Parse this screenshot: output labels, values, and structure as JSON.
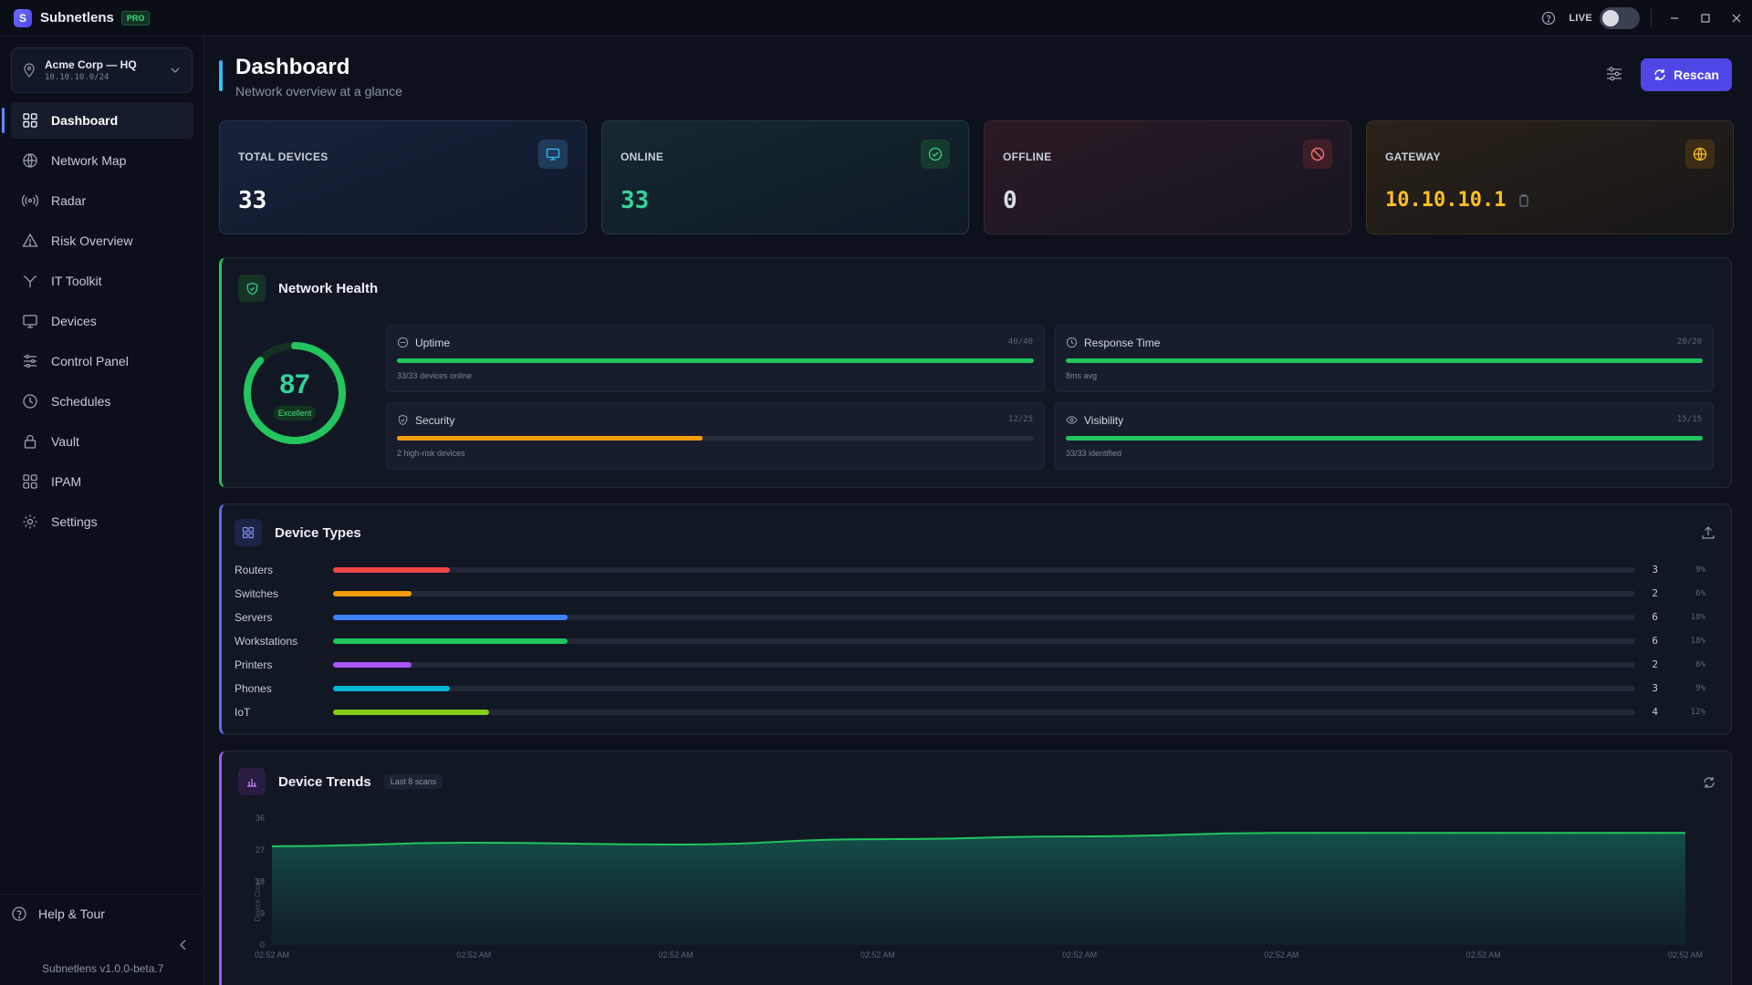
{
  "app": {
    "name": "Subnetlens",
    "badge": "PRO",
    "live_label": "LIVE",
    "version": "Subnetlens v1.0.0-beta.7"
  },
  "site": {
    "name": "Acme Corp — HQ",
    "subnet": "10.10.10.0/24"
  },
  "sidebar": {
    "items": [
      {
        "label": "Dashboard",
        "icon": "grid-icon",
        "active": true
      },
      {
        "label": "Network Map",
        "icon": "globe-icon"
      },
      {
        "label": "Radar",
        "icon": "radar-icon"
      },
      {
        "label": "Risk Overview",
        "icon": "warning-icon"
      },
      {
        "label": "IT Toolkit",
        "icon": "toolkit-icon"
      },
      {
        "label": "Devices",
        "icon": "monitor-icon"
      },
      {
        "label": "Control Panel",
        "icon": "sliders-icon"
      },
      {
        "label": "Schedules",
        "icon": "clock-icon"
      },
      {
        "label": "Vault",
        "icon": "lock-icon"
      },
      {
        "label": "IPAM",
        "icon": "ipam-icon"
      },
      {
        "label": "Settings",
        "icon": "gear-icon"
      }
    ],
    "help_label": "Help & Tour"
  },
  "header": {
    "title": "Dashboard",
    "subtitle": "Network overview at a glance",
    "rescan_label": "Rescan"
  },
  "stats": {
    "total": {
      "label": "TOTAL DEVICES",
      "value": "33",
      "color": "#ffffff"
    },
    "online": {
      "label": "ONLINE",
      "value": "33",
      "color": "#34d399"
    },
    "offline": {
      "label": "OFFLINE",
      "value": "0",
      "color": "#d8dce4"
    },
    "gateway": {
      "label": "GATEWAY",
      "value": "10.10.10.1",
      "color": "#fbbf24"
    }
  },
  "health": {
    "title": "Network Health",
    "score": "87",
    "score_fraction": 0.87,
    "rating": "Excellent",
    "metrics": {
      "uptime": {
        "label": "Uptime",
        "score": "40/40",
        "sub": "33/33 devices online",
        "fraction": 1.0,
        "color": "#22c55e"
      },
      "response": {
        "label": "Response Time",
        "score": "20/20",
        "sub": "8ms avg",
        "fraction": 1.0,
        "color": "#22c55e"
      },
      "security": {
        "label": "Security",
        "score": "12/25",
        "sub": "2 high-risk devices",
        "fraction": 0.48,
        "color": "#f59e0b"
      },
      "visibility": {
        "label": "Visibility",
        "score": "15/15",
        "sub": "33/33 identified",
        "fraction": 1.0,
        "color": "#22c55e"
      }
    }
  },
  "device_types": {
    "title": "Device Types",
    "rows": [
      {
        "label": "Routers",
        "count": "3",
        "pct": "9%",
        "fraction": 0.09,
        "color": "#ef4444"
      },
      {
        "label": "Switches",
        "count": "2",
        "pct": "6%",
        "fraction": 0.06,
        "color": "#f59e0b"
      },
      {
        "label": "Servers",
        "count": "6",
        "pct": "18%",
        "fraction": 0.18,
        "color": "#3b82f6"
      },
      {
        "label": "Workstations",
        "count": "6",
        "pct": "18%",
        "fraction": 0.18,
        "color": "#22c55e"
      },
      {
        "label": "Printers",
        "count": "2",
        "pct": "6%",
        "fraction": 0.06,
        "color": "#a855f7"
      },
      {
        "label": "Phones",
        "count": "3",
        "pct": "9%",
        "fraction": 0.09,
        "color": "#06b6d4"
      },
      {
        "label": "IoT",
        "count": "4",
        "pct": "12%",
        "fraction": 0.12,
        "color": "#84cc16"
      }
    ]
  },
  "trends": {
    "title": "Device Trends",
    "range": "Last 8 scans"
  },
  "chart_data": {
    "type": "area",
    "title": "Device Trends",
    "ylabel": "Device Count",
    "ylim": [
      0,
      36
    ],
    "yticks": [
      "0",
      "9",
      "18",
      "27",
      "36"
    ],
    "x": [
      "02:52 AM",
      "02:52 AM",
      "02:52 AM",
      "02:52 AM",
      "02:52 AM",
      "02:52 AM",
      "02:52 AM",
      "02:52 AM"
    ],
    "series": [
      {
        "values": [
          28,
          29,
          28.5,
          30,
          30.8,
          31.8,
          31.8,
          31.8
        ],
        "color": "#22c55e"
      }
    ]
  }
}
